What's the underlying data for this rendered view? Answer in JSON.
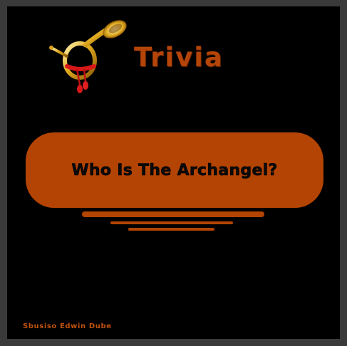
{
  "title": "Trivia",
  "question": "Who Is The Archangel?",
  "author": "Sbusiso Edwin Dube",
  "colors": {
    "background": "#000000",
    "frame": "#3a3a3a",
    "accent": "#b34403",
    "question_text": "#0a0a0a"
  },
  "icons": {
    "horn": "post-horn-icon"
  }
}
